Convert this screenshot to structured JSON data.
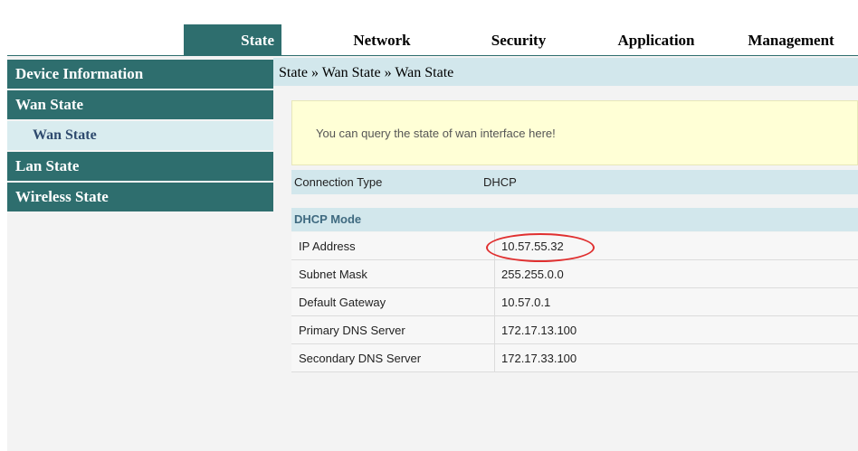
{
  "nav": {
    "tabs": [
      {
        "label": "State"
      },
      {
        "label": "Network"
      },
      {
        "label": "Security"
      },
      {
        "label": "Application"
      },
      {
        "label": "Management"
      }
    ]
  },
  "sidebar": {
    "items": [
      {
        "label": "Device Information"
      },
      {
        "label": "Wan State"
      },
      {
        "label": "Wan State"
      },
      {
        "label": "Lan State"
      },
      {
        "label": "Wireless State"
      }
    ]
  },
  "main": {
    "breadcrumb": "State » Wan State » Wan State",
    "notice": "You can query the state of wan interface here!",
    "connection_type": {
      "label": "Connection Type",
      "value": "DHCP"
    },
    "mode_title": "DHCP Mode",
    "rows": [
      {
        "label": "IP Address",
        "value": "10.57.55.32"
      },
      {
        "label": "Subnet Mask",
        "value": "255.255.0.0"
      },
      {
        "label": "Default Gateway",
        "value": "10.57.0.1"
      },
      {
        "label": "Primary DNS Server",
        "value": "172.17.13.100"
      },
      {
        "label": "Secondary DNS Server",
        "value": "172.17.33.100"
      }
    ]
  },
  "colors": {
    "accent": "#2e6e6e",
    "header_bg": "#d2e7ec",
    "notice_bg": "#ffffd6",
    "annotation": "#e03030"
  }
}
